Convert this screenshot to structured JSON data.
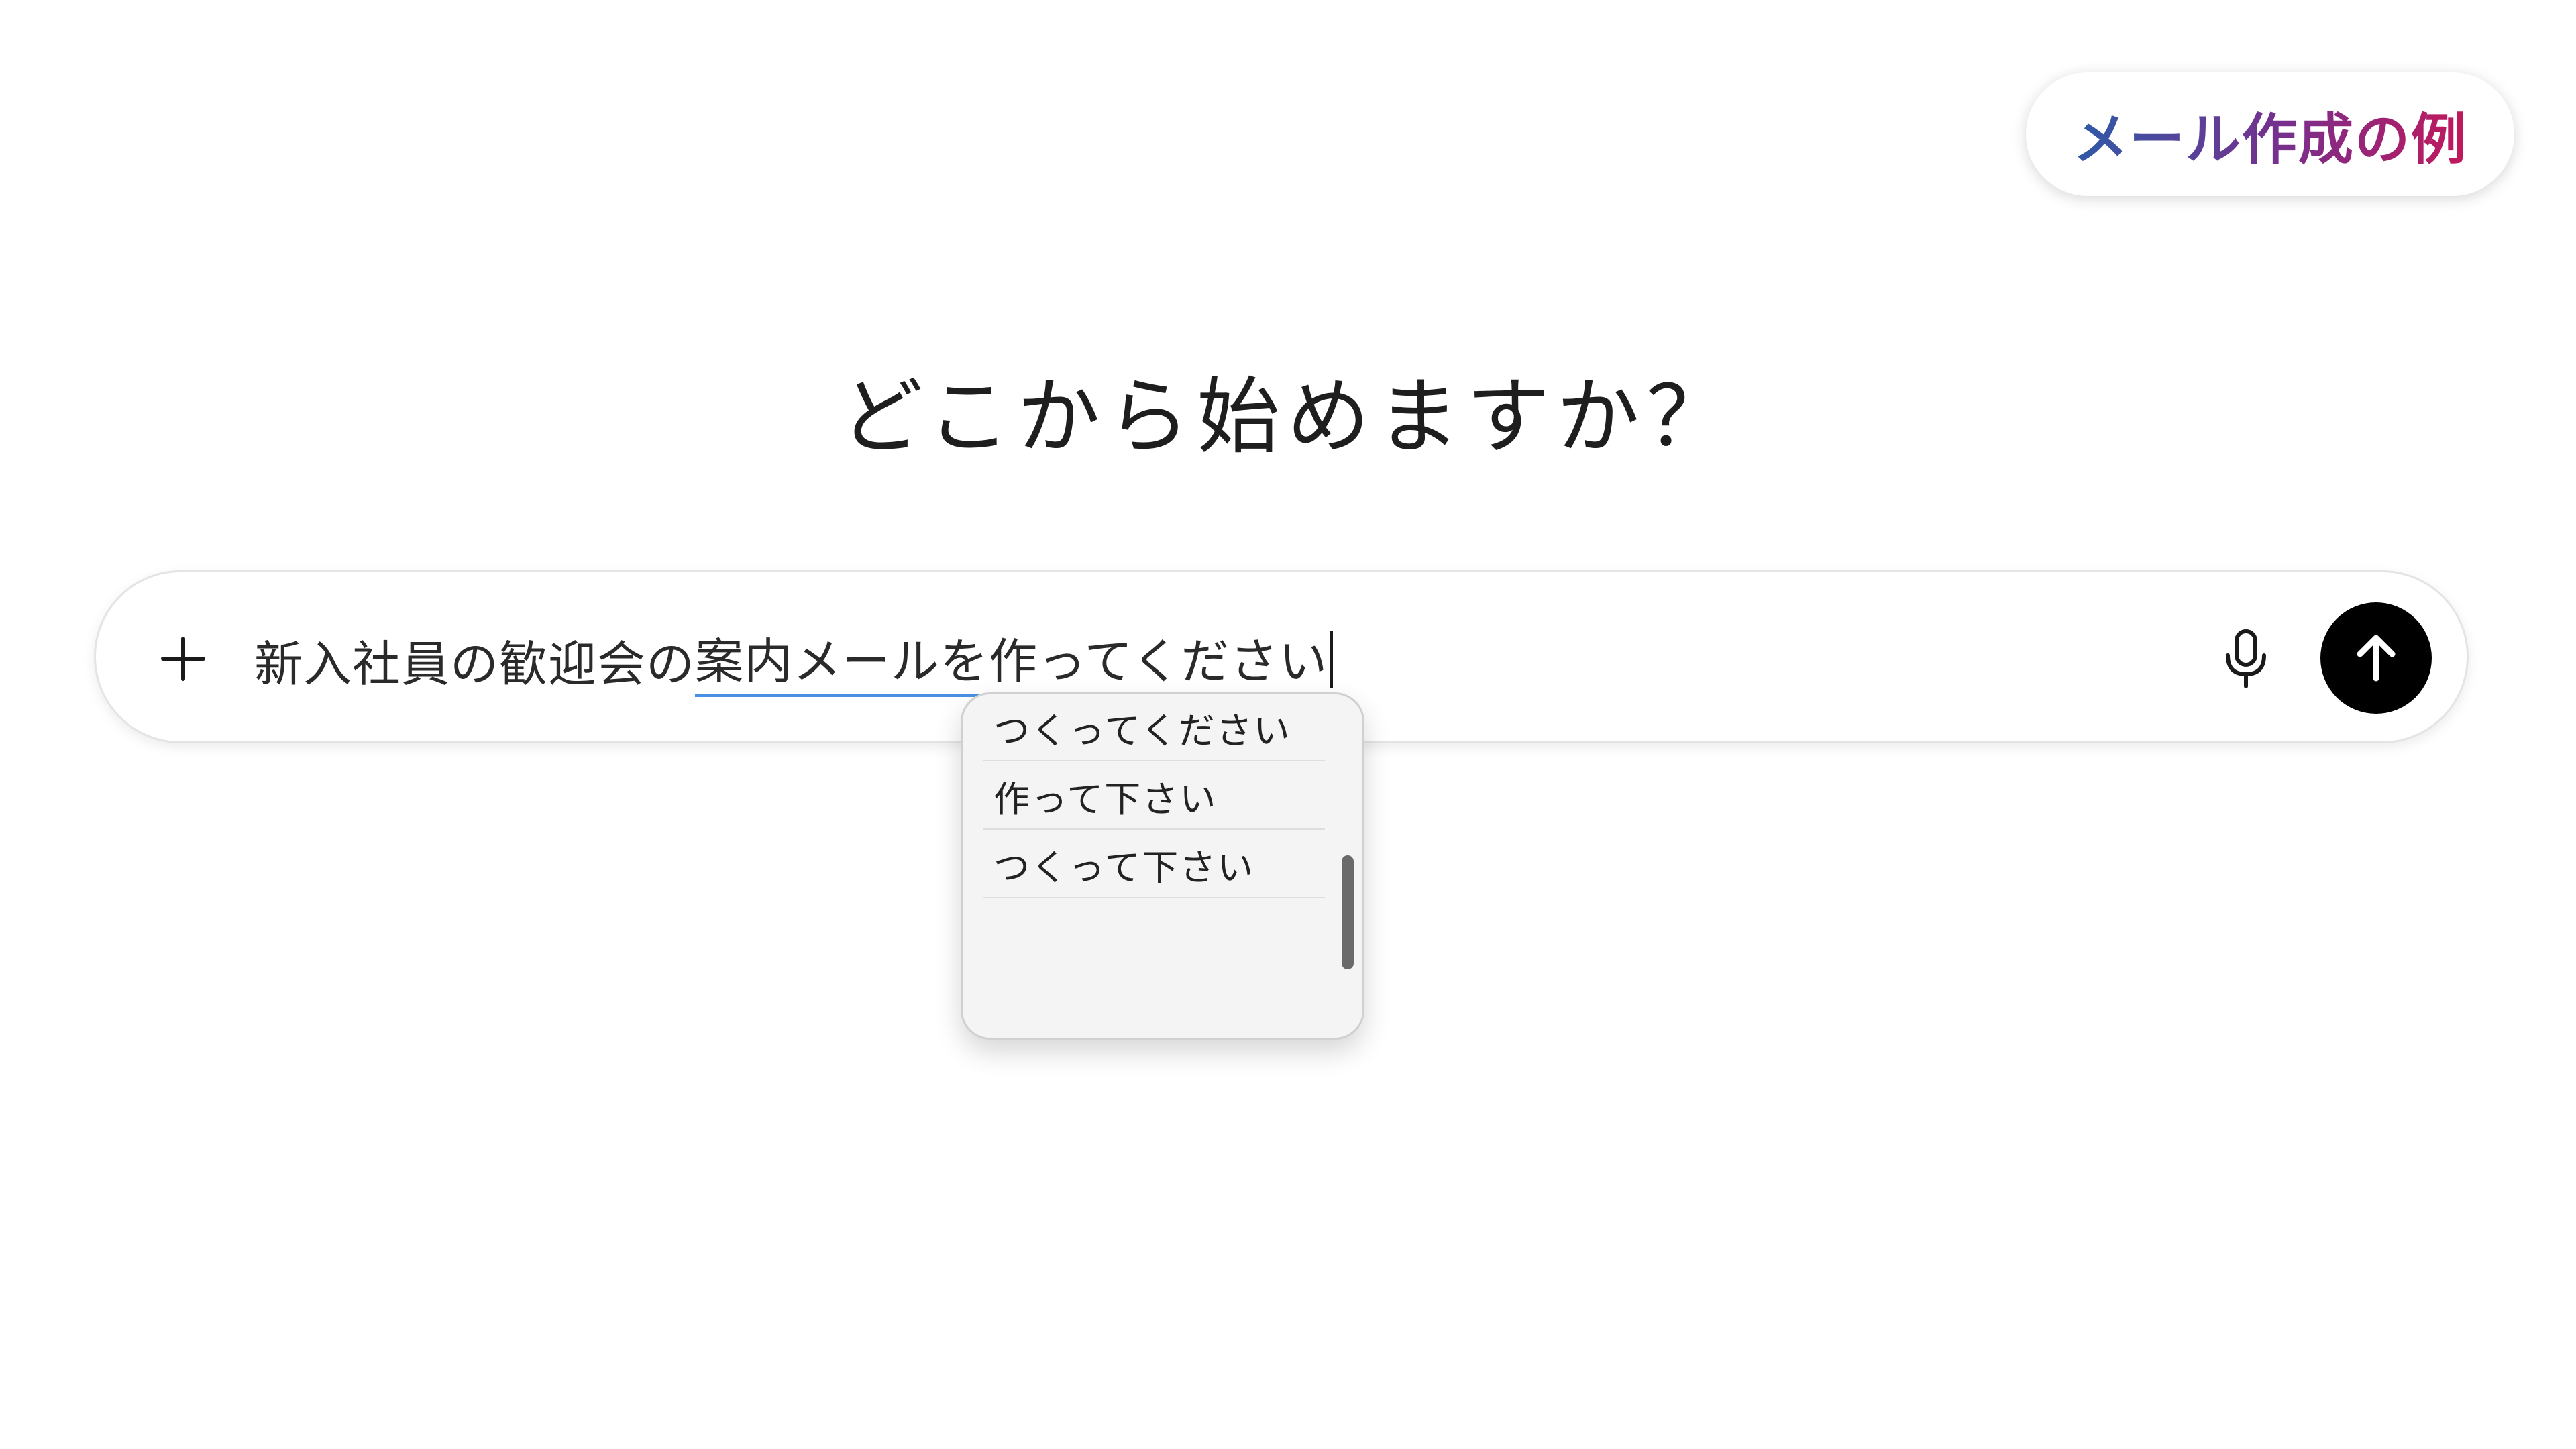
{
  "badge": {
    "label": "メール作成の例"
  },
  "heading": "どこから始めますか？",
  "prompt": {
    "text_confirmed": "新入社員の歓迎会の",
    "text_composing": "案内メールを作ってください",
    "plus_icon": "plus-icon",
    "mic_icon": "microphone-icon",
    "send_icon": "arrow-up-icon"
  },
  "candidates": {
    "items": [
      {
        "label": "つくってください"
      },
      {
        "label": "作って下さい"
      },
      {
        "label": "つくって下さい"
      }
    ]
  },
  "colors": {
    "send_button": "#000000",
    "composition_underline": "#4a90e2",
    "badge_gradient_start": "#2e5aa8",
    "badge_gradient_end": "#c2185b"
  }
}
